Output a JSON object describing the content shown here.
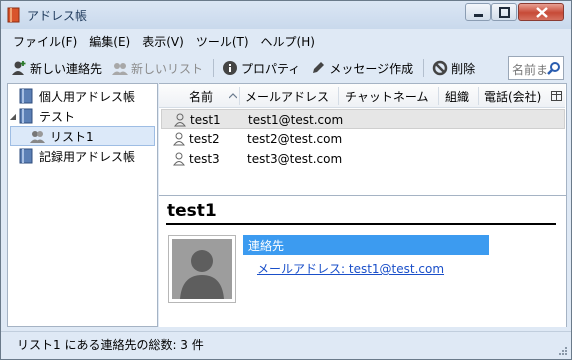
{
  "window": {
    "title": "アドレス帳"
  },
  "menu": [
    "ファイル(F)",
    "編集(E)",
    "表示(V)",
    "ツール(T)",
    "ヘルプ(H)"
  ],
  "toolbar": {
    "new_contact": "新しい連絡先",
    "new_list": "新しいリスト",
    "properties": "プロパティ",
    "compose": "メッセージ作成",
    "delete": "削除",
    "search_placeholder": "名前ま"
  },
  "tree": [
    {
      "label": "個人用アドレス帳",
      "icon": "address-book-icon"
    },
    {
      "label": "テスト",
      "icon": "address-book-icon",
      "expanded": true
    },
    {
      "label": "リスト1",
      "icon": "mailing-list-icon",
      "selected": true
    },
    {
      "label": "記録用アドレス帳",
      "icon": "address-book-icon"
    }
  ],
  "list": {
    "columns": [
      "名前",
      "メールアドレス",
      "チャットネーム",
      "組織",
      "電話(会社)"
    ],
    "rows": [
      {
        "name": "test1",
        "email": "test1@test.com",
        "selected": true
      },
      {
        "name": "test2",
        "email": "test2@test.com"
      },
      {
        "name": "test3",
        "email": "test3@test.com"
      }
    ]
  },
  "detail": {
    "name": "test1",
    "section": "連絡先",
    "email_line": "メールアドレス: test1@test.com"
  },
  "status": "リスト1 にある連絡先の総数: 3 件",
  "colors": {
    "selection_blue": "#3c9bf0",
    "link": "#1a4fc9",
    "chrome": "#dfe9f5"
  }
}
